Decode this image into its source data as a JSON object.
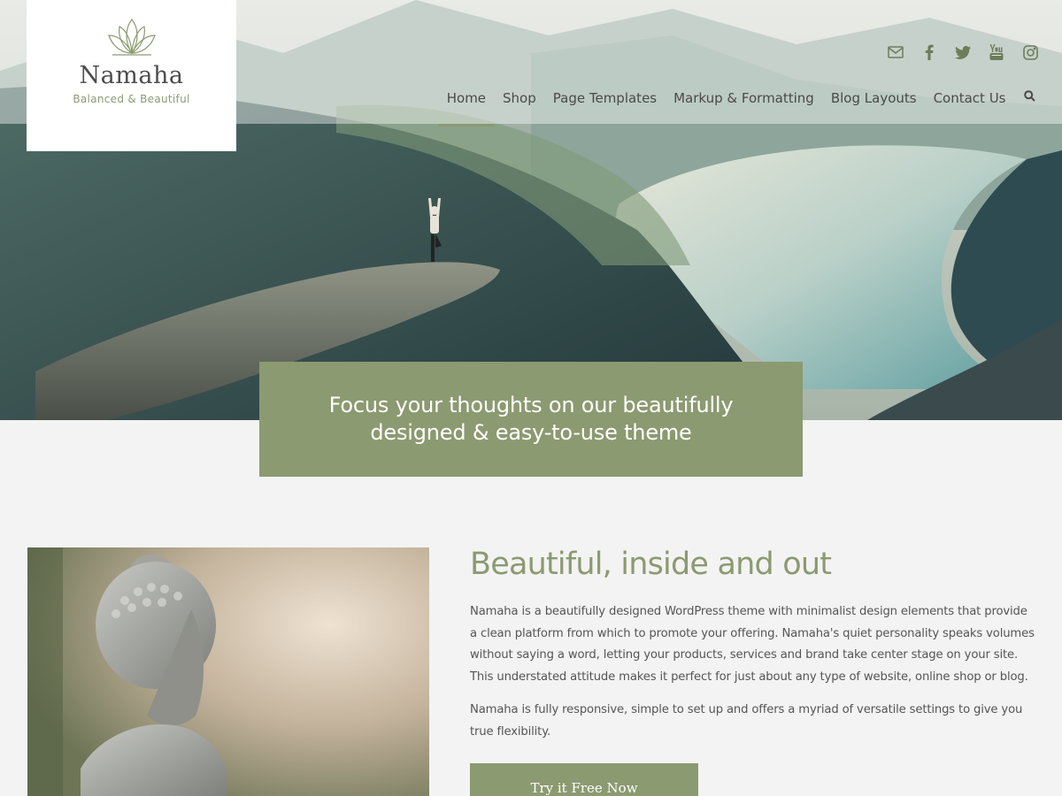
{
  "colors": {
    "accent": "#8b9a70",
    "background": "#f3f3f3",
    "text": "#555555"
  },
  "logo": {
    "name": "Namaha",
    "tagline": "Balanced & Beautiful",
    "icon": "lotus-icon"
  },
  "social": [
    {
      "icon": "mail-icon"
    },
    {
      "icon": "facebook-icon"
    },
    {
      "icon": "twitter-icon"
    },
    {
      "icon": "youtube-icon"
    },
    {
      "icon": "instagram-icon"
    }
  ],
  "nav": {
    "items": [
      "Home",
      "Shop",
      "Page Templates",
      "Markup & Formatting",
      "Blog Layouts",
      "Contact Us"
    ],
    "active": "Home",
    "search_icon": "search-icon"
  },
  "hero": {
    "banner_text": "Focus your thoughts on our beautifully designed & easy-to-use theme"
  },
  "intro": {
    "heading": "Beautiful, inside and out",
    "paragraph1": "Namaha is a beautifully designed WordPress theme with minimalist design elements that provide a clean platform from which to promote your offering. Namaha's quiet personality speaks volumes without saying a word, letting your products, services and brand take center stage on your site. This understated attitude makes it perfect for just about any type of website, online shop or blog.",
    "paragraph2": "Namaha is fully responsive, simple to set up and offers a myriad of versatile settings to give you true flexibility.",
    "button": "Try it Free Now"
  }
}
